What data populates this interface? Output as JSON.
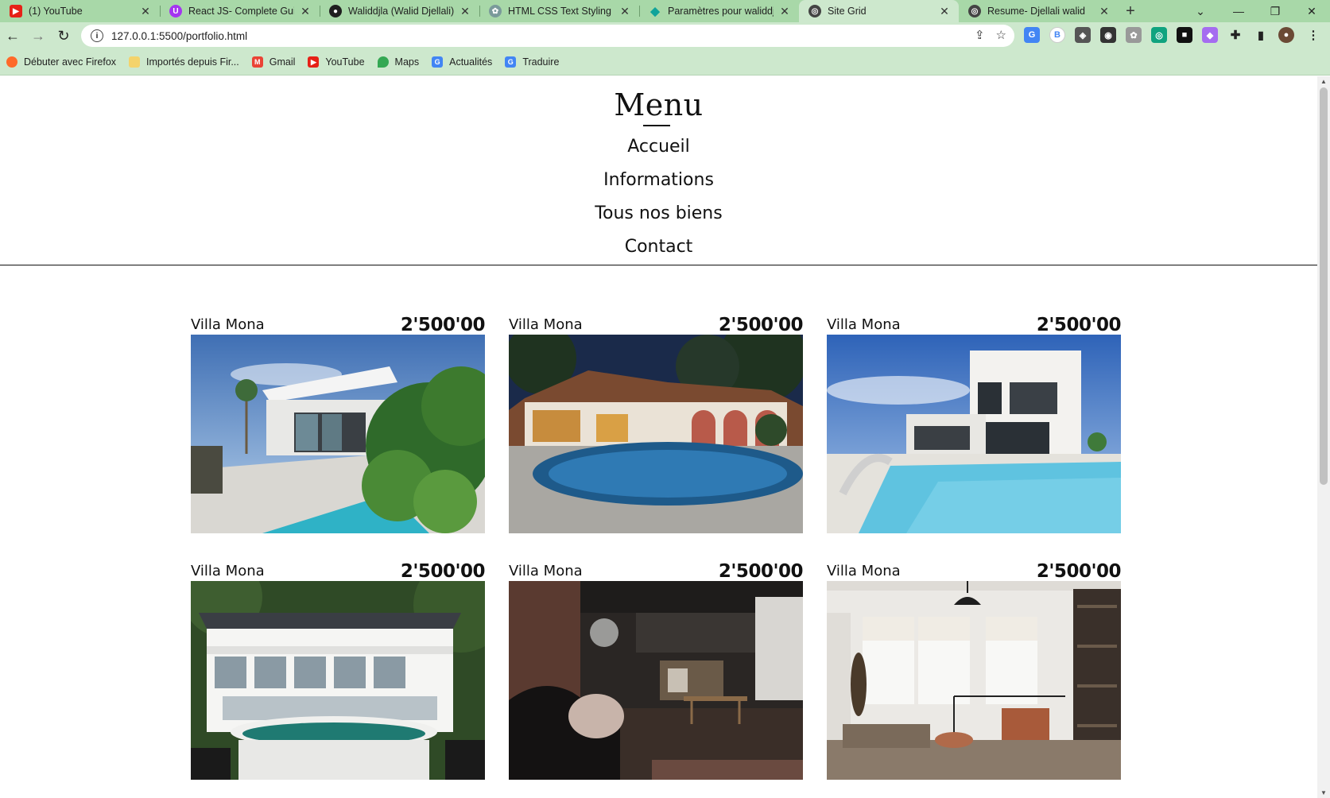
{
  "browser": {
    "tabs": [
      {
        "title": "(1) YouTube",
        "favicon": "youtube-icon",
        "color": "#e62117",
        "active": false
      },
      {
        "title": "React JS- Complete Guide",
        "favicon": "udemy-icon",
        "color": "#a435f0",
        "active": false
      },
      {
        "title": "Waliddjla (Walid Djellali)",
        "favicon": "github-icon",
        "color": "#1f1f1f",
        "active": false
      },
      {
        "title": "HTML CSS Text Styling",
        "favicon": "openai-icon",
        "color": "#7a9a9a",
        "active": false
      },
      {
        "title": "Paramètres pour waliddjela",
        "favicon": "diamond-icon",
        "color": "#10a39a",
        "active": false
      },
      {
        "title": "Site Grid",
        "favicon": "globe-icon",
        "color": "#444444",
        "active": true
      },
      {
        "title": "Resume- Djellali walid",
        "favicon": "globe-icon",
        "color": "#444444",
        "active": false
      }
    ],
    "url": "127.0.0.1:5500/portfolio.html",
    "bookmarks": [
      {
        "label": "Débuter avec Firefox",
        "icon": "firefox-icon",
        "color": "#ff6a2a"
      },
      {
        "label": "Importés depuis Fir...",
        "icon": "folder-icon",
        "color": "#f4d36b"
      },
      {
        "label": "Gmail",
        "icon": "gmail-icon",
        "color": "#ea4335"
      },
      {
        "label": "YouTube",
        "icon": "youtube-icon",
        "color": "#e62117"
      },
      {
        "label": "Maps",
        "icon": "maps-icon",
        "color": "#34a853"
      },
      {
        "label": "Actualités",
        "icon": "news-icon",
        "color": "#4285f4"
      },
      {
        "label": "Traduire",
        "icon": "translate-icon",
        "color": "#4285f4"
      }
    ]
  },
  "page": {
    "menu_title": "Menu",
    "nav": [
      "Accueil",
      "Informations",
      "Tous nos biens",
      "Contact"
    ],
    "listings": [
      {
        "name": "Villa Mona",
        "price": "2'500'00",
        "image": "modern-villa-with-plants"
      },
      {
        "name": "Villa Mona",
        "price": "2'500'00",
        "image": "night-villa-round-pool"
      },
      {
        "name": "Villa Mona",
        "price": "2'500'00",
        "image": "white-cube-villa-pool"
      },
      {
        "name": "Villa Mona",
        "price": "2'500'00",
        "image": "beach-house-green-pool"
      },
      {
        "name": "Villa Mona",
        "price": "2'500'00",
        "image": "industrial-loft-living-room"
      },
      {
        "name": "Villa Mona",
        "price": "2'500'00",
        "image": "bright-loft-bedroom"
      }
    ]
  }
}
